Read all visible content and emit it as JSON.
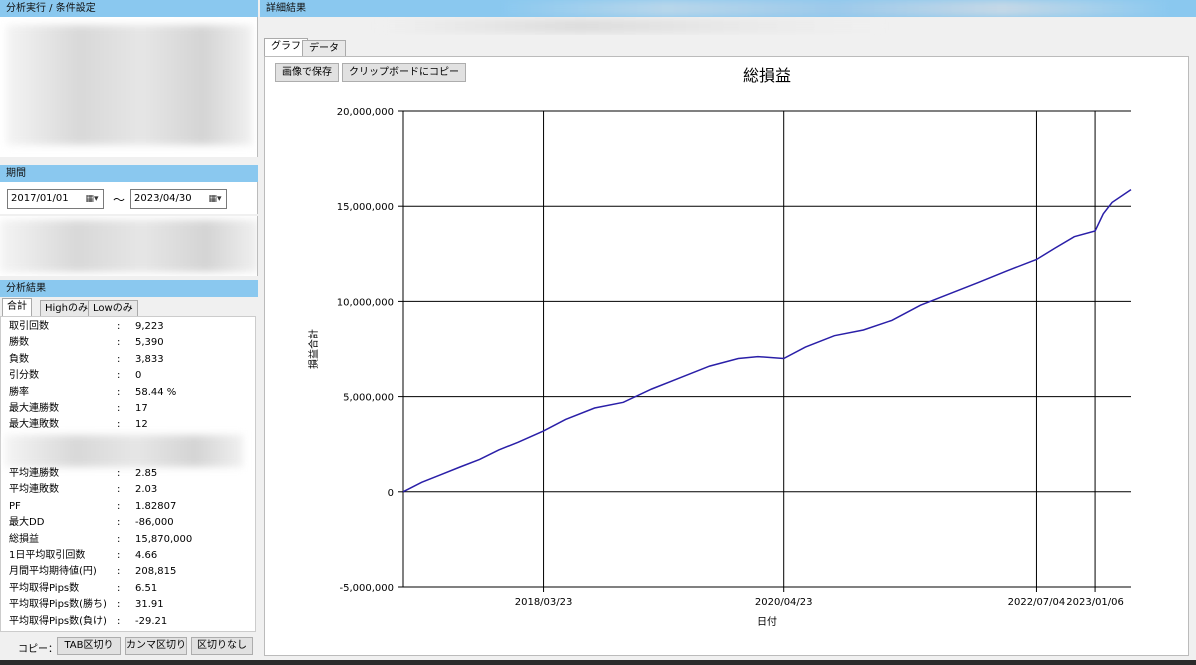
{
  "left": {
    "condition_header": "分析実行 / 条件設定",
    "period_header": "期間",
    "period": {
      "start": "2017/01/01",
      "tilde": "～",
      "end": "2023/04/30",
      "calendar_glyph": "▦▾"
    },
    "result_header": "分析結果",
    "result_tabs": [
      "合計",
      "Highのみ",
      "Lowのみ"
    ],
    "colon": ":",
    "stats_top": [
      {
        "label": "取引回数",
        "value": "9,223"
      },
      {
        "label": "勝数",
        "value": "5,390"
      },
      {
        "label": "負数",
        "value": "3,833"
      },
      {
        "label": "引分数",
        "value": "0"
      },
      {
        "label": "勝率",
        "value": "58.44 %"
      },
      {
        "label": "最大連勝数",
        "value": "17"
      },
      {
        "label": "最大連敗数",
        "value": "12"
      }
    ],
    "stats_bottom": [
      {
        "label": "平均連勝数",
        "value": "2.85"
      },
      {
        "label": "平均連敗数",
        "value": "2.03"
      },
      {
        "label": "PF",
        "value": "1.82807"
      },
      {
        "label": "最大DD",
        "value": "-86,000"
      },
      {
        "label": "総損益",
        "value": "15,870,000"
      },
      {
        "label": "1日平均取引回数",
        "value": "4.66"
      },
      {
        "label": "月間平均期待値(円)",
        "value": "208,815"
      },
      {
        "label": "平均取得Pips数",
        "value": "6.51"
      },
      {
        "label": "平均取得Pips数(勝ち)",
        "value": "31.91"
      },
      {
        "label": "平均取得Pips数(負け)",
        "value": "-29.21"
      }
    ],
    "copy_label": "コピー：",
    "copy_buttons": [
      "TAB区切り",
      "カンマ区切り",
      "区切りなし"
    ]
  },
  "right": {
    "header": "詳細結果",
    "tabs": [
      "グラフ",
      "データ"
    ],
    "save_image_label": "画像で保存",
    "copy_clipboard_label": "クリップボードにコピー"
  },
  "chart_data": {
    "type": "line",
    "title": "総損益",
    "xlabel": "日付",
    "ylabel": "損益合計",
    "ylim": [
      -5000000,
      20000000
    ],
    "yticks": [
      -5000000,
      0,
      5000000,
      10000000,
      15000000,
      20000000
    ],
    "ytick_labels": [
      "-5,000,000",
      "0",
      "5,000,000",
      "10,000,000",
      "15,000,000",
      "20,000,000"
    ],
    "xlim": [
      "2017-01-01",
      "2023-04-30"
    ],
    "xticks": [
      "2018-03-23",
      "2020-04-23",
      "2022-07-04",
      "2023-01-06"
    ],
    "xtick_labels": [
      "2018/03/23",
      "2020/04/23",
      "2022/07/04",
      "2023/01/06"
    ],
    "grid": true,
    "line_color": "#2a1fa8",
    "series": [
      {
        "x": [
          "2017-01-01",
          "2017-03-01",
          "2017-05-01",
          "2017-07-01",
          "2017-09-01",
          "2017-11-01",
          "2018-01-01",
          "2018-03-23",
          "2018-06-01",
          "2018-09-01",
          "2018-12-01",
          "2019-03-01",
          "2019-06-01",
          "2019-09-01",
          "2019-12-01",
          "2020-02-01",
          "2020-04-23",
          "2020-07-01",
          "2020-10-01",
          "2021-01-01",
          "2021-04-01",
          "2021-07-01",
          "2021-10-01",
          "2022-01-01",
          "2022-04-01",
          "2022-07-04",
          "2022-09-01",
          "2022-11-01",
          "2023-01-06",
          "2023-02-01",
          "2023-03-01",
          "2023-04-30"
        ],
        "y": [
          0,
          500000,
          900000,
          1300000,
          1700000,
          2200000,
          2600000,
          3200000,
          3800000,
          4400000,
          4700000,
          5400000,
          6000000,
          6600000,
          7000000,
          7100000,
          7000000,
          7600000,
          8200000,
          8500000,
          9000000,
          9800000,
          10400000,
          11000000,
          11600000,
          12200000,
          12800000,
          13400000,
          13700000,
          14600000,
          15200000,
          15870000
        ]
      }
    ]
  }
}
